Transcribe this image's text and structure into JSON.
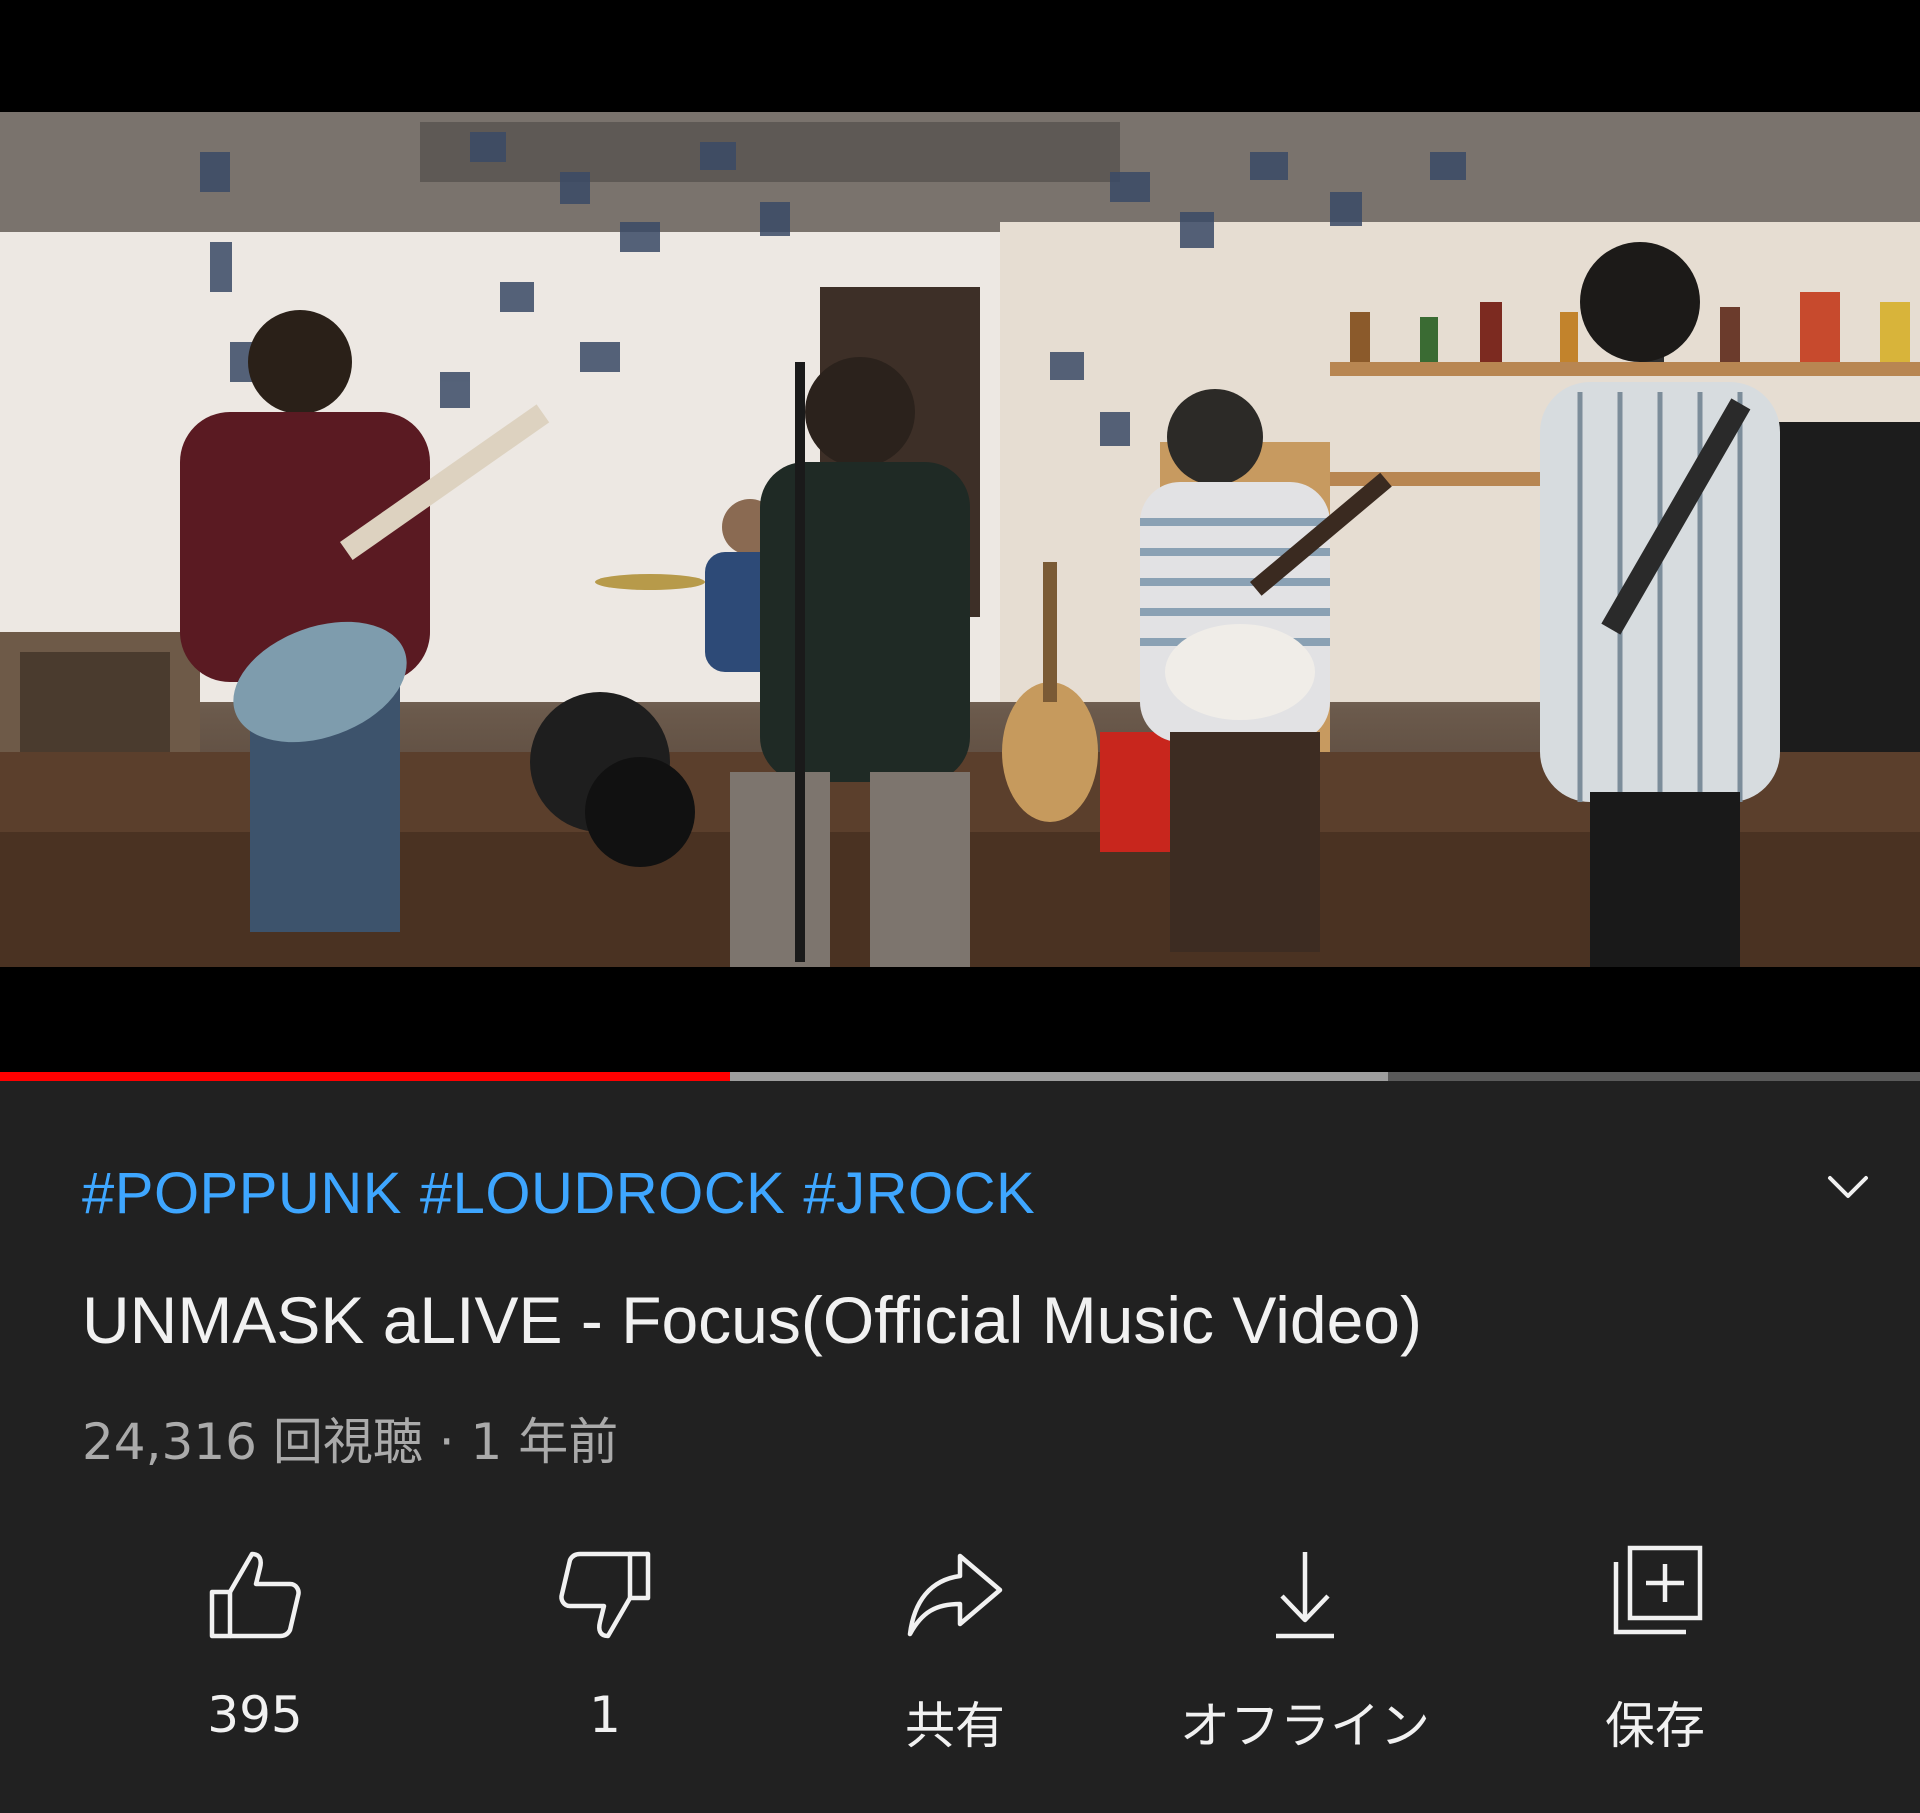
{
  "video": {
    "description_icon": "band-performance-scene",
    "progress": {
      "played_fraction": 0.38,
      "buffered_fraction": 0.723
    }
  },
  "info": {
    "hashtags": [
      "#POPPUNK",
      "#LOUDROCK",
      "#JROCK"
    ],
    "title": "UNMASK aLIVE - Focus(Official Music Video)",
    "meta": "24,316 回視聴 · 1 年前",
    "expand_icon": "chevron-down-icon"
  },
  "actions": [
    {
      "icon": "thumbs-up-icon",
      "label": "395"
    },
    {
      "icon": "thumbs-down-icon",
      "label": "1"
    },
    {
      "icon": "share-icon",
      "label": "共有"
    },
    {
      "icon": "download-icon",
      "label": "オフライン"
    },
    {
      "icon": "save-playlist-icon",
      "label": "保存"
    }
  ],
  "colors": {
    "panel_bg": "#212121",
    "hashtag": "#3ea6ff",
    "progress_played": "#ff0000",
    "progress_buffered": "#9e9e9e",
    "text_primary": "#f1f1f1",
    "text_secondary": "#aaaaaa"
  }
}
